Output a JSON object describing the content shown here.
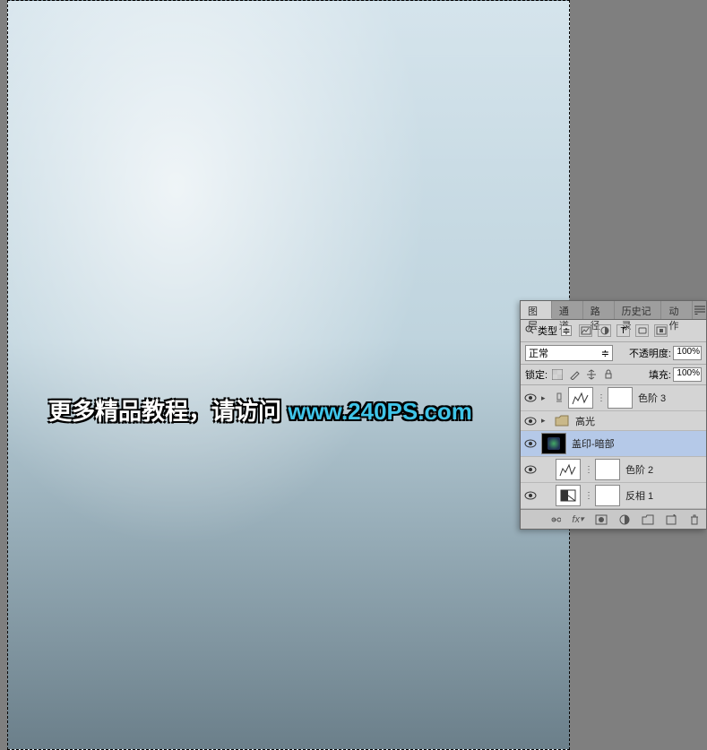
{
  "watermark": {
    "text_prefix": "更多精品教程，请访问 ",
    "url": "www.240PS.com"
  },
  "panel": {
    "tabs": [
      "图层",
      "通道",
      "路径",
      "历史记录",
      "动作"
    ],
    "active_tab": 0,
    "filter": {
      "type_label": "类型",
      "dropdown_arrow": "≑"
    },
    "blend": {
      "mode": "正常",
      "opacity_label": "不透明度:",
      "opacity_value": "100%"
    },
    "lock": {
      "label": "锁定:",
      "fill_label": "填充:",
      "fill_value": "100%"
    },
    "layers": [
      {
        "type": "adj",
        "name": "色阶 3",
        "has_mask": true,
        "selected": false
      },
      {
        "type": "group",
        "name": "高光",
        "selected": false
      },
      {
        "type": "pixel",
        "name": "盖印-暗部",
        "selected": true,
        "dark_thumb": true
      },
      {
        "type": "adj-levels",
        "name": "色阶 2",
        "has_mask": true,
        "indent": true,
        "selected": false
      },
      {
        "type": "adj-invert",
        "name": "反相 1",
        "has_mask": true,
        "indent": true,
        "selected": false
      }
    ],
    "footer_icons": [
      "link",
      "fx",
      "mask",
      "adj",
      "group",
      "new",
      "trash"
    ]
  }
}
